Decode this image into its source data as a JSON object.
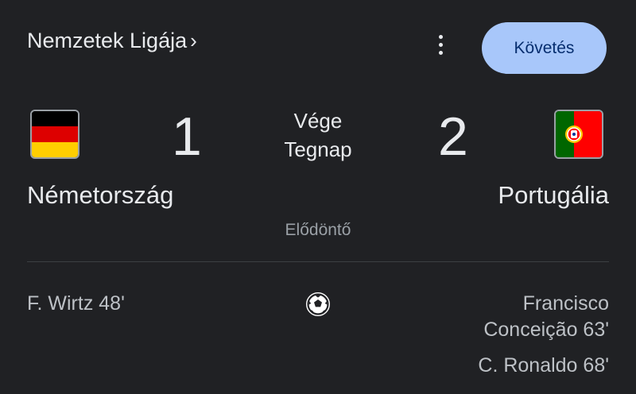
{
  "header": {
    "league": "Nemzetek Ligája",
    "league_chevron": "›",
    "follow_label": "Követés"
  },
  "match": {
    "home": {
      "name": "Németország",
      "score": "1",
      "flag_colors": [
        "#000000",
        "#dd0000",
        "#ffce00"
      ]
    },
    "away": {
      "name": "Portugália",
      "score": "2",
      "flag_colors": [
        "#006600",
        "#ff0000",
        "#ffcc00"
      ]
    },
    "status": "Vége",
    "date": "Tegnap",
    "stage": "Elődöntő"
  },
  "scorers": {
    "home": [
      "F. Wirtz 48'"
    ],
    "away": [
      "Francisco",
      "Conceição 63'",
      "C. Ronaldo 68'"
    ]
  },
  "colors": {
    "background": "#202124",
    "button_bg": "#a8c7fa",
    "button_text": "#062e6f",
    "muted_text": "#9aa0a6"
  }
}
